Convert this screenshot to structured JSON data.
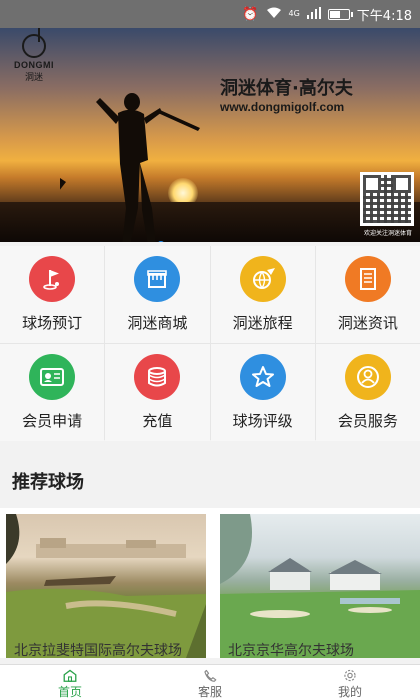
{
  "status_bar": {
    "time": "下午4:18",
    "battery_level": 0.6,
    "network": "4G",
    "icons": [
      "alarm-icon",
      "wifi-icon",
      "signal-icon",
      "battery-icon"
    ]
  },
  "banner": {
    "logo_brand": "DONGMI",
    "logo_cn": "洞迷",
    "title": "洞迷体育·高尔夫",
    "url": "www.dongmigolf.com",
    "qr_caption": "欢迎关注洞迷体育",
    "slide_index": 1,
    "slide_count": 1
  },
  "menu": [
    {
      "label": "球场预订",
      "icon": "golf-flag-icon",
      "color": "#e8474a"
    },
    {
      "label": "洞迷商城",
      "icon": "shop-icon",
      "color": "#2f8fe0"
    },
    {
      "label": "洞迷旅程",
      "icon": "globe-plane-icon",
      "color": "#f0b41c"
    },
    {
      "label": "洞迷资讯",
      "icon": "news-document-icon",
      "color": "#f07a24"
    },
    {
      "label": "会员申请",
      "icon": "member-card-icon",
      "color": "#2fb45a"
    },
    {
      "label": "充值",
      "icon": "coins-icon",
      "color": "#e8474a"
    },
    {
      "label": "球场评级",
      "icon": "star-icon",
      "color": "#2f8fe0"
    },
    {
      "label": "会员服务",
      "icon": "user-service-icon",
      "color": "#f0b41c"
    }
  ],
  "section": {
    "title": "推荐球场"
  },
  "courses": [
    {
      "name": "北京拉斐特国际高尔夫球场"
    },
    {
      "name": "北京京华高尔夫球场"
    }
  ],
  "tabs": [
    {
      "label": "首页",
      "icon": "home-icon",
      "active": true
    },
    {
      "label": "客服",
      "icon": "phone-icon",
      "active": false
    },
    {
      "label": "我的",
      "icon": "gear-icon",
      "active": false
    }
  ]
}
